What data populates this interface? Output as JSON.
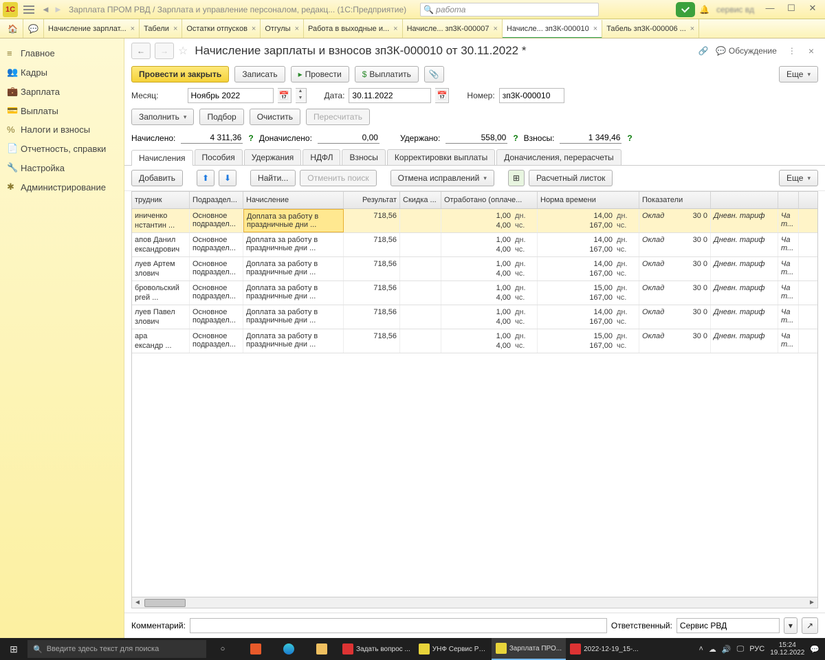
{
  "titlebar": {
    "logo": "1C",
    "app_title": "Зарплата ПРОМ РВД / Зарплата и управление персоналом, редакц...   (1С:Предприятие)",
    "search_icon": "🔍",
    "search_value": "работа",
    "user": "сервис вд",
    "min": "—",
    "max": "☐",
    "close": "✕"
  },
  "tabs": [
    {
      "label": "Начисление зарплат...",
      "closable": true
    },
    {
      "label": "Табели",
      "closable": true
    },
    {
      "label": "Остатки отпусков",
      "closable": true
    },
    {
      "label": "Отгулы",
      "closable": true
    },
    {
      "label": "Работа в выходные и...",
      "closable": true
    },
    {
      "label": "Начисле... зп3К-000007",
      "closable": true
    },
    {
      "label": "Начисле... зп3К-000010",
      "closable": true,
      "active": true
    },
    {
      "label": "Табель зп3К-000006 ...",
      "closable": true
    }
  ],
  "sidebar": [
    {
      "icon": "≡",
      "label": "Главное"
    },
    {
      "icon": "👥",
      "label": "Кадры"
    },
    {
      "icon": "💼",
      "label": "Зарплата"
    },
    {
      "icon": "💳",
      "label": "Выплаты"
    },
    {
      "icon": "%",
      "label": "Налоги и взносы"
    },
    {
      "icon": "📄",
      "label": "Отчетность, справки"
    },
    {
      "icon": "🔧",
      "label": "Настройка"
    },
    {
      "icon": "✱",
      "label": "Администрирование"
    }
  ],
  "doc": {
    "back": "←",
    "fwd": "→",
    "star": "☆",
    "title": "Начисление зарплаты и взносов зп3К-000010 от 30.11.2022 *",
    "link_icon": "🔗",
    "discussion_icon": "💬",
    "discussion": "Обсуждение",
    "menu": "⋮",
    "close": "×"
  },
  "actions": {
    "post_close": "Провести и закрыть",
    "write": "Записать",
    "post": "Провести",
    "pay": "Выплатить",
    "attach": "📎",
    "more": "Еще",
    "caret": "▾"
  },
  "fields": {
    "month_label": "Месяц:",
    "month_value": "Ноябрь 2022",
    "date_label": "Дата:",
    "date_value": "30.11.2022",
    "number_label": "Номер:",
    "number_value": "зп3К-000010"
  },
  "actions2": {
    "fill": "Заполнить",
    "pick": "Подбор",
    "clear": "Очистить",
    "recalc": "Пересчитать"
  },
  "totals": {
    "accrued_label": "Начислено:",
    "accrued": "4 311,36",
    "extra_label": "Доначислено:",
    "extra": "0,00",
    "withheld_label": "Удержано:",
    "withheld": "558,00",
    "contrib_label": "Взносы:",
    "contrib": "1 349,46",
    "help": "?"
  },
  "subtabs": [
    "Начисления",
    "Пособия",
    "Удержания",
    "НДФЛ",
    "Взносы",
    "Корректировки выплаты",
    "Доначисления, перерасчеты"
  ],
  "gridbar": {
    "add": "Добавить",
    "find": "Найти...",
    "cancel_search": "Отменить поиск",
    "cancel_fix": "Отмена исправлений",
    "payslip": "Расчетный листок",
    "more": "Еще"
  },
  "columns": [
    "трудник",
    "Подраздел...",
    "Начисление",
    "Результат",
    "Скидка ...",
    "Отработано (оплаче...",
    "Норма времени",
    "Показатели"
  ],
  "rows": [
    {
      "emp1": "иниченко",
      "emp2": "нстантин ...",
      "dep": "Основное подраздел...",
      "accr": "Доплата за работу в праздничные дни ...",
      "res": "718,56",
      "d": "1,00",
      "du": "дн.",
      "h": "4,00",
      "hu": "чс.",
      "nd": "14,00",
      "ndu": "дн.",
      "nh": "167,00",
      "nhu": "чс.",
      "ind1": "Оклад",
      "ind1v": "30 0",
      "ind2": "Дневн. тариф",
      "tail": "Ча т..."
    },
    {
      "emp1": "апов Данил",
      "emp2": "ександрович",
      "dep": "Основное подраздел...",
      "accr": "Доплата за работу в праздничные дни ...",
      "res": "718,56",
      "d": "1,00",
      "du": "дн.",
      "h": "4,00",
      "hu": "чс.",
      "nd": "14,00",
      "ndu": "дн.",
      "nh": "167,00",
      "nhu": "чс.",
      "ind1": "Оклад",
      "ind1v": "30 0",
      "ind2": "Дневн. тариф",
      "tail": "Ча т..."
    },
    {
      "emp1": "луев Артем",
      "emp2": "злович",
      "dep": "Основное подраздел...",
      "accr": "Доплата за работу в праздничные дни ...",
      "res": "718,56",
      "d": "1,00",
      "du": "дн.",
      "h": "4,00",
      "hu": "чс.",
      "nd": "14,00",
      "ndu": "дн.",
      "nh": "167,00",
      "nhu": "чс.",
      "ind1": "Оклад",
      "ind1v": "30 0",
      "ind2": "Дневн. тариф",
      "tail": "Ча т..."
    },
    {
      "emp1": "бровольский",
      "emp2": "ргей ...",
      "dep": "Основное подраздел...",
      "accr": "Доплата за работу в праздничные дни ...",
      "res": "718,56",
      "d": "1,00",
      "du": "дн.",
      "h": "4,00",
      "hu": "чс.",
      "nd": "15,00",
      "ndu": "дн.",
      "nh": "167,00",
      "nhu": "чс.",
      "ind1": "Оклад",
      "ind1v": "30 0",
      "ind2": "Дневн. тариф",
      "tail": "Ча т..."
    },
    {
      "emp1": "луев Павел",
      "emp2": "злович",
      "dep": "Основное подраздел...",
      "accr": "Доплата за работу в праздничные дни ...",
      "res": "718,56",
      "d": "1,00",
      "du": "дн.",
      "h": "4,00",
      "hu": "чс.",
      "nd": "14,00",
      "ndu": "дн.",
      "nh": "167,00",
      "nhu": "чс.",
      "ind1": "Оклад",
      "ind1v": "30 0",
      "ind2": "Дневн. тариф",
      "tail": "Ча т..."
    },
    {
      "emp1": "ара",
      "emp2": "ександр ...",
      "dep": "Основное подраздел...",
      "accr": "Доплата за работу в праздничные дни ...",
      "res": "718,56",
      "d": "1,00",
      "du": "дн.",
      "h": "4,00",
      "hu": "чс.",
      "nd": "15,00",
      "ndu": "дн.",
      "nh": "167,00",
      "nhu": "чс.",
      "ind1": "Оклад",
      "ind1v": "30 0",
      "ind2": "Дневн. тариф",
      "tail": "Ча т..."
    }
  ],
  "comment": {
    "label": "Комментарий:",
    "resp_label": "Ответственный:",
    "resp_value": "Сервис РВД"
  },
  "taskbar": {
    "search_placeholder": "Введите здесь текст для поиска",
    "items": [
      {
        "label": "Задать вопрос ...",
        "color": "#d33"
      },
      {
        "label": "УНФ Сервис РВ...",
        "color": "#e8d43a"
      },
      {
        "label": "Зарплата ПРО...",
        "color": "#e8d43a",
        "active": true
      },
      {
        "label": "2022-12-19_15-...",
        "color": "#d33"
      }
    ],
    "lang": "РУС",
    "time": "15:24",
    "date": "19.12.2022"
  }
}
